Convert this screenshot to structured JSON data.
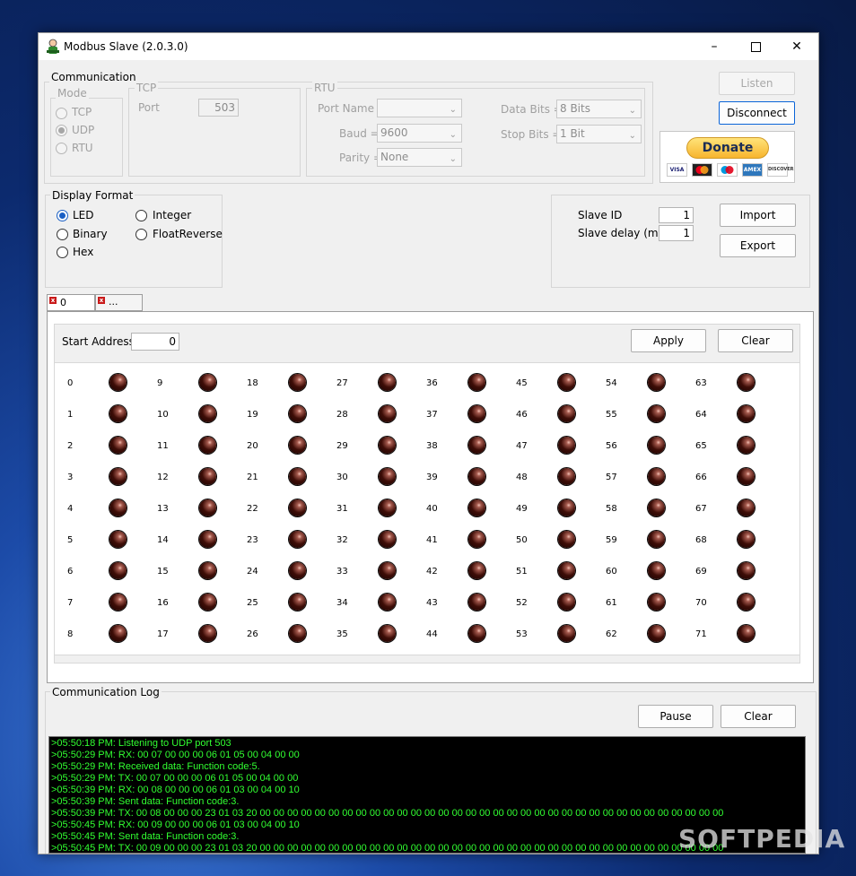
{
  "window": {
    "title": "Modbus Slave (2.0.3.0)"
  },
  "communication": {
    "label": "Communication",
    "mode": {
      "label": "Mode",
      "options": [
        "TCP",
        "UDP",
        "RTU"
      ],
      "selected": "UDP"
    },
    "tcp": {
      "label": "TCP",
      "port_label": "Port",
      "port_value": "503"
    },
    "rtu": {
      "label": "RTU",
      "port_name_label": "Port Name =",
      "port_name_value": "",
      "baud_label": "Baud =",
      "baud_value": "9600",
      "parity_label": "Parity =",
      "parity_value": "None",
      "data_bits_label": "Data Bits =",
      "data_bits_value": "8 Bits",
      "stop_bits_label": "Stop Bits =",
      "stop_bits_value": "1 Bit"
    }
  },
  "buttons": {
    "listen": "Listen",
    "disconnect": "Disconnect",
    "import": "Import",
    "export": "Export",
    "apply": "Apply",
    "clear": "Clear",
    "pause": "Pause",
    "log_clear": "Clear"
  },
  "donate": {
    "label": "Donate",
    "cards": [
      "VISA",
      "MC",
      "MAESTRO",
      "AMEX",
      "DISCOVER"
    ]
  },
  "display_format": {
    "label": "Display Format",
    "options": [
      "LED",
      "Integer",
      "Binary",
      "FloatReverse",
      "Hex"
    ],
    "selected": "LED"
  },
  "slave": {
    "id_label": "Slave ID",
    "id_value": "1",
    "delay_label": "Slave delay (ms)",
    "delay_value": "1"
  },
  "tabs": [
    {
      "label": "0"
    },
    {
      "label": "..."
    }
  ],
  "start_address": {
    "label": "Start Address",
    "value": "0"
  },
  "coils": {
    "addresses": [
      "0",
      "1",
      "2",
      "3",
      "4",
      "5",
      "6",
      "7",
      "8",
      "9",
      "10",
      "11",
      "12",
      "13",
      "14",
      "15",
      "16",
      "17",
      "18",
      "19",
      "20",
      "21",
      "22",
      "23",
      "24",
      "25",
      "26",
      "27",
      "28",
      "29",
      "30",
      "31",
      "32",
      "33",
      "34",
      "35",
      "36",
      "37",
      "38",
      "39",
      "40",
      "41",
      "42",
      "43",
      "44",
      "45",
      "46",
      "47",
      "48",
      "49",
      "50",
      "51",
      "52",
      "53",
      "54",
      "55",
      "56",
      "57",
      "58",
      "59",
      "60",
      "61",
      "62",
      "63",
      "64",
      "65",
      "66",
      "67",
      "68",
      "69",
      "70",
      "71"
    ],
    "states": "all-off"
  },
  "log": {
    "label": "Communication Log",
    "lines": [
      ">05:50:18 PM: Listening to UDP port 503",
      ">05:50:29 PM: RX: 00 07 00 00 00 06 01 05 00 04 00 00",
      ">05:50:29 PM: Received data: Function code:5.",
      ">05:50:29 PM: TX: 00 07 00 00 00 06 01 05 00 04 00 00",
      ">05:50:39 PM: RX: 00 08 00 00 00 06 01 03 00 04 00 10",
      ">05:50:39 PM: Sent data: Function code:3.",
      ">05:50:39 PM: TX: 00 08 00 00 00 23 01 03 20 00 00 00 00 00 00 00 00 00 00 00 00 00 00 00 00 00 00 00 00 00 00 00 00 00 00 00 00 00 00 00 00 00 00",
      ">05:50:45 PM: RX: 00 09 00 00 00 06 01 03 00 04 00 10",
      ">05:50:45 PM: Sent data: Function code:3.",
      ">05:50:45 PM: TX: 00 09 00 00 00 23 01 03 20 00 00 00 00 00 00 00 00 00 00 00 00 00 00 00 00 00 00 00 00 00 00 00 00 00 00 00 00 00 00 00 00 00 00"
    ]
  },
  "watermark": "SOFTPEDIA"
}
